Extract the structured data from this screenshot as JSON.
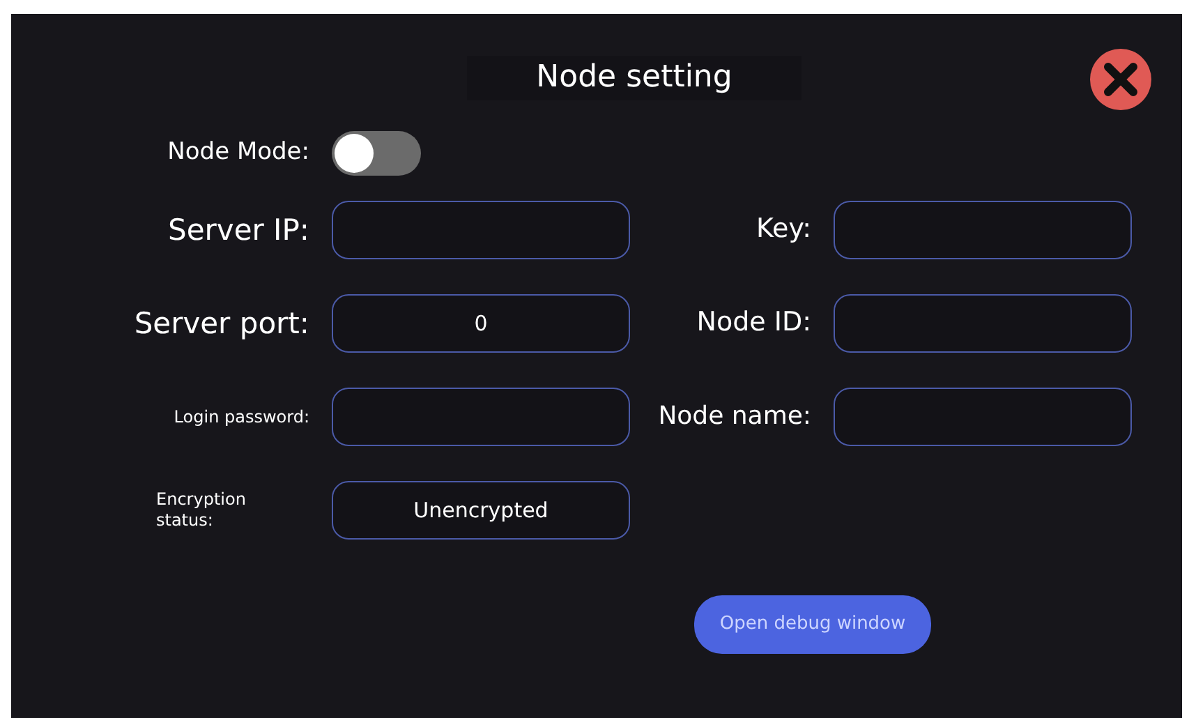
{
  "title": "Node setting",
  "node_mode": {
    "label": "Node Mode:",
    "on": false
  },
  "left_fields": [
    {
      "label": "Server IP:"
    },
    {
      "label": "Server port:",
      "value": "0"
    },
    {
      "label": "Login password:"
    },
    {
      "label": "Encryption status:",
      "value": "Unencrypted"
    }
  ],
  "right_fields": [
    {
      "label": "Key:"
    },
    {
      "label": "Node ID:"
    },
    {
      "label": "Node name:"
    }
  ],
  "button": "Open debug window"
}
